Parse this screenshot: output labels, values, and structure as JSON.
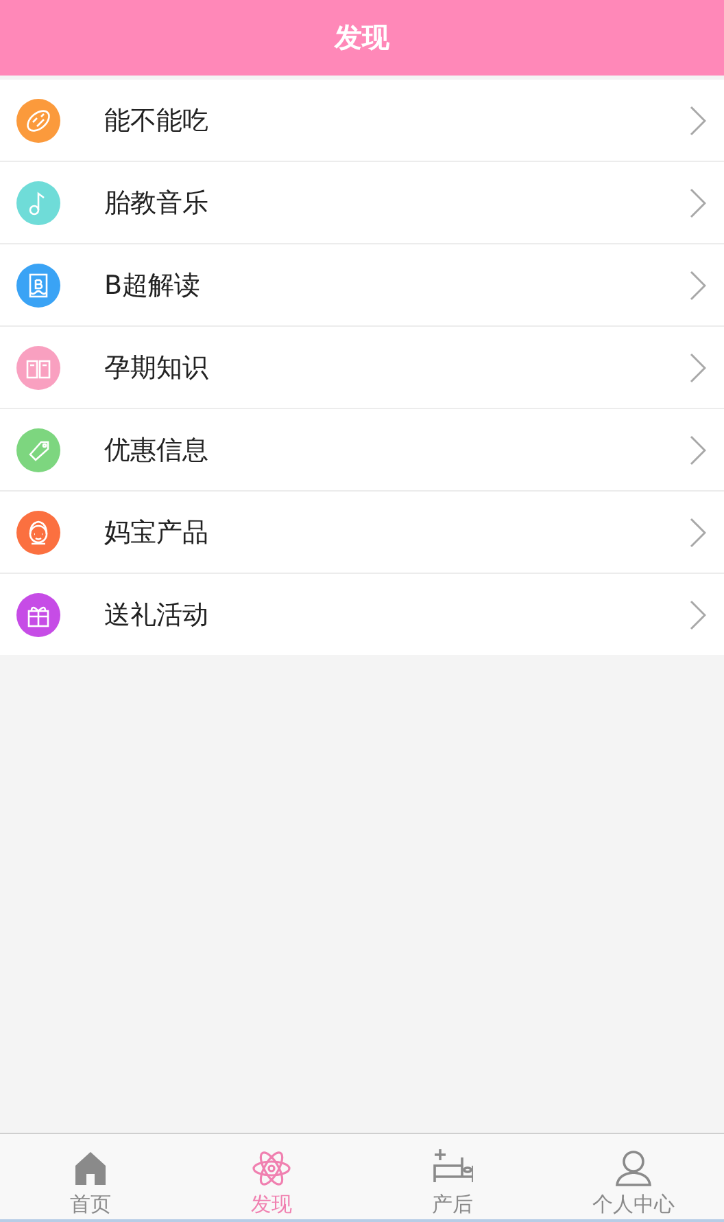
{
  "header": {
    "title": "发现"
  },
  "items": [
    {
      "label": "能不能吃",
      "kind": "bread",
      "color": "#fb9a3c"
    },
    {
      "label": "胎教音乐",
      "kind": "note",
      "color": "#6fdcd8"
    },
    {
      "label": "B超解读",
      "kind": "scan",
      "color": "#3aa3f5"
    },
    {
      "label": "孕期知识",
      "kind": "book",
      "color": "#f9a0c0"
    },
    {
      "label": "优惠信息",
      "kind": "tag",
      "color": "#7dd67f"
    },
    {
      "label": "妈宝产品",
      "kind": "baby",
      "color": "#fb7040"
    },
    {
      "label": "送礼活动",
      "kind": "gift",
      "color": "#c64ce6"
    }
  ],
  "tabs": [
    {
      "label": "首页",
      "kind": "home",
      "selected": false
    },
    {
      "label": "发现",
      "kind": "atom",
      "selected": true
    },
    {
      "label": "产后",
      "kind": "bed",
      "selected": false
    },
    {
      "label": "个人中心",
      "kind": "person",
      "selected": false
    }
  ]
}
